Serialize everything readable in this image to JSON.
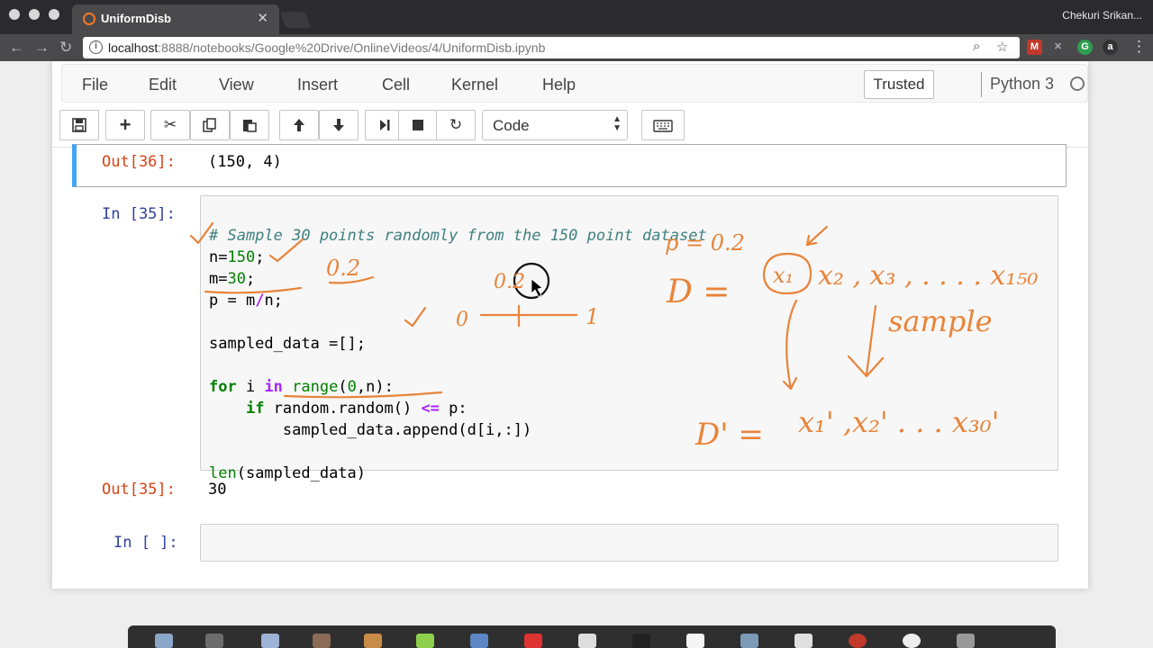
{
  "browser": {
    "tab_title": "UniformDisb",
    "tab_close": "✕",
    "profile_name": "Chekuri Srikan...",
    "url_host": "localhost",
    "url_path": ":8888/notebooks/Google%20Drive/OnlineVideos/4/UniformDisb.ipynb"
  },
  "menu": {
    "items": [
      "File",
      "Edit",
      "View",
      "Insert",
      "Cell",
      "Kernel",
      "Help"
    ],
    "trusted": "Trusted",
    "kernel": "Python 3"
  },
  "toolbar": {
    "cell_type": "Code"
  },
  "cells": {
    "prev_out_prompt": "Out[36]:",
    "prev_out_value": "(150, 4)",
    "in_prompt": "In [35]:",
    "out_prompt": "Out[35]:",
    "out_value": "30",
    "empty_prompt": "In [ ]:",
    "code": {
      "l1": "# Sample 30 points randomly from the 150 point dataset",
      "l2_var": "n=",
      "l2_num": "150",
      "l2_end": ";",
      "l3_var": "m=",
      "l3_num": "30",
      "l3_end": ";",
      "l4_a": "p = m",
      "l4_op": "/",
      "l4_b": "n;",
      "l5": "sampled_data =[];",
      "l6_for": "for",
      "l6_i": " i ",
      "l6_in": "in",
      "l6_sp": " ",
      "l6_range": "range",
      "l6_open": "(",
      "l6_zero": "0",
      "l6_rest": ",n):",
      "l7_if": "if",
      "l7_call": " random.random() ",
      "l7_op": "<=",
      "l7_p": " p:",
      "l8": "sampled_data.append(d[i,:])",
      "l9_len": "len",
      "l9_rest": "(sampled_data)"
    }
  },
  "annotations": {
    "p_value": "0.2",
    "p_cursor": "0.2",
    "range_start": "0",
    "range_end": "1",
    "p_eq": "p = 0.2",
    "D": "D =",
    "x1": "x₁",
    "xs": "x₂ , x₃ , . . . . x₁₅₀",
    "sample": "sample",
    "Dprime": "D' =",
    "xprime": "x₁' ,x₂' . . .   x₃₀'"
  },
  "colors": {
    "ink": "#e8843a",
    "in_prompt": "#303F9F",
    "out_prompt": "#D84315",
    "selected_cell": "#42A5F5"
  }
}
